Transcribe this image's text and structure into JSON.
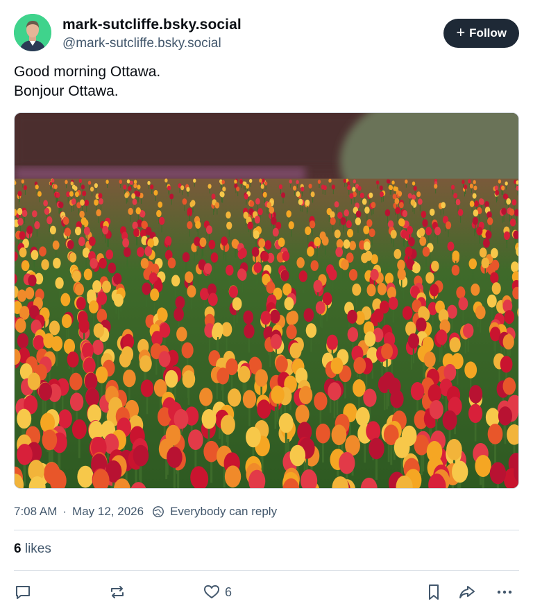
{
  "author": {
    "display_name": "mark-sutcliffe.bsky.social",
    "handle": "@mark-sutcliffe.bsky.social",
    "avatar_bg": "#3fd38c"
  },
  "follow_button": {
    "icon": "plus-icon",
    "label": "Follow"
  },
  "post": {
    "lines": [
      "Good morning Ottawa.",
      "Bonjour Ottawa."
    ],
    "image": {
      "subject": "tulip-field-photo"
    }
  },
  "meta": {
    "time": "7:08 AM",
    "separator": "·",
    "date": "May 12, 2026",
    "reply_setting_icon": "globe-icon",
    "reply_setting": "Everybody can reply"
  },
  "stats": {
    "likes_count": "6",
    "likes_label": "likes"
  },
  "actions": {
    "reply_icon": "speech-bubble-icon",
    "repost_icon": "repost-arrows-icon",
    "like_icon": "heart-icon",
    "like_count": "6",
    "bookmark_icon": "bookmark-icon",
    "share_icon": "share-arrow-icon",
    "more_icon": "ellipsis-icon"
  },
  "colors": {
    "follow_bg": "#1e2936",
    "muted_text": "#42576c",
    "divider": "#d4dbe2"
  }
}
